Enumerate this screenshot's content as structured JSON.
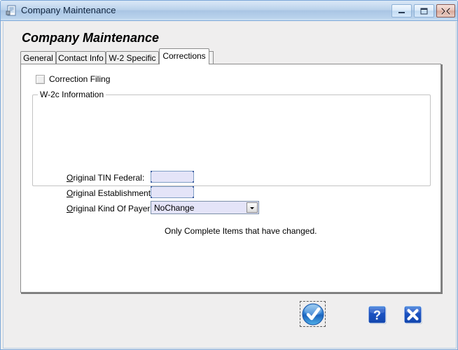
{
  "window": {
    "title": "Company Maintenance",
    "icon": "document-window-icon",
    "controls": {
      "minimize": "minimize-icon",
      "maximize": "maximize-icon",
      "close": "close-icon"
    }
  },
  "form": {
    "heading": "Company Maintenance"
  },
  "tabs": [
    {
      "id": "general",
      "label": "General",
      "active": false
    },
    {
      "id": "contact-info",
      "label": "Contact Info",
      "active": false
    },
    {
      "id": "w2-specific",
      "label": "W-2 Specific",
      "active": false
    },
    {
      "id": "corrections",
      "label": "Corrections",
      "active": true
    }
  ],
  "corrections": {
    "correction_filing": {
      "label": "Correction Filing",
      "checked": false,
      "enabled": false
    },
    "groupbox": {
      "title": "W-2c Information",
      "fields": [
        {
          "id": "original-tin-federal",
          "label_accel": "O",
          "label_rest": "riginal TIN Federal:",
          "value": "",
          "placeholder": ""
        },
        {
          "id": "original-establishment",
          "label_accel": "O",
          "label_rest": "riginal Establishment:",
          "value": "",
          "placeholder": ""
        },
        {
          "id": "original-kind-of-payer",
          "label_accel": "O",
          "label_rest": "riginal Kind Of Payer:",
          "value": "NoChange",
          "options": [
            "NoChange"
          ]
        }
      ],
      "note": "Only Complete Items that have changed."
    }
  },
  "buttons": {
    "ok": {
      "name": "ok-button",
      "icon": "blue-check-icon",
      "focused": true
    },
    "help": {
      "name": "help-button",
      "icon": "question-mark-icon"
    },
    "cancel": {
      "name": "cancel-button",
      "icon": "x-mark-icon"
    }
  },
  "colors": {
    "titlebar_blue": "#a9c5e4",
    "frame_border": "#7ca7d8",
    "field_background": "#e4e4f8",
    "field_border": "#7f9dc4",
    "button_blue": "#1a55c8",
    "panel_background": "#ffffff",
    "dialog_background": "#efeeee"
  }
}
